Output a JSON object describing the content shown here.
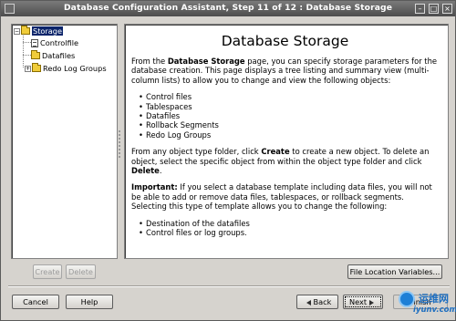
{
  "window": {
    "title": "Database Configuration Assistant, Step 11 of 12 : Database Storage",
    "controls": [
      "minimize",
      "maximize",
      "close"
    ]
  },
  "tree": {
    "root": {
      "label": "Storage",
      "expanded": true,
      "selected": true
    },
    "children": [
      {
        "label": "Controlfile",
        "icon": "controlfile-icon"
      },
      {
        "label": "Datafiles",
        "icon": "folder-icon",
        "expander": "+"
      },
      {
        "label": "Redo Log Groups",
        "icon": "folder-icon",
        "expander": "+"
      }
    ]
  },
  "content": {
    "title": "Database Storage",
    "intro": {
      "before": "From the ",
      "bold": "Database Storage",
      "after": " page, you can specify storage parameters for the database creation. This page displays a tree listing and summary view (multi-column lists) to allow you to change and view the following objects:"
    },
    "objects": [
      "Control files",
      "Tablespaces",
      "Datafiles",
      "Rollback Segments",
      "Redo Log Groups"
    ],
    "create_text": {
      "p1": "From any object type folder, click ",
      "b1": "Create",
      "p2": " to create a new object. To delete an object, select the specific object from within the object type folder and click ",
      "b2": "Delete",
      "p3": "."
    },
    "important": {
      "label": "Important:",
      "text": " If you select a database template including data files, you will not be able to add or remove data files, tablespaces, or rollback segments. Selecting this type of template allows you to change the following:"
    },
    "changeable": [
      "Destination of the datafiles",
      "Control files or log groups."
    ]
  },
  "buttons": {
    "create": "Create",
    "delete": "Delete",
    "file_location": "File Location Variables...",
    "cancel": "Cancel",
    "help": "Help",
    "back": "Back",
    "next": "Next",
    "finish": "Finish"
  },
  "watermark": {
    "cn": "运维网",
    "url": "iyunv.com"
  }
}
